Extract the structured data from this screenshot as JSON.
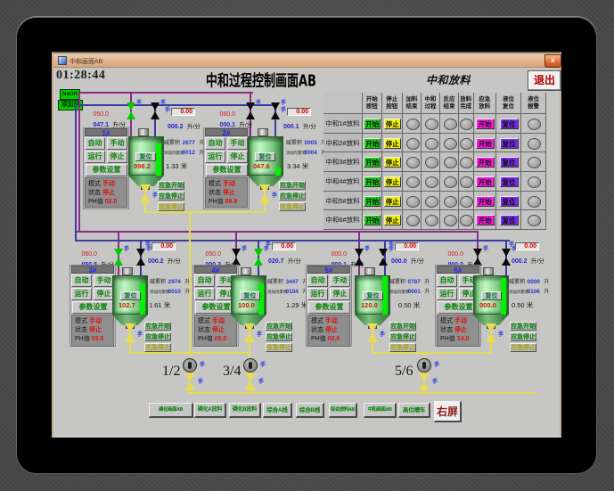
{
  "window": {
    "title": "中和画面AB",
    "close_label": "x"
  },
  "header": {
    "clock": "01:28:44",
    "title": "中和过程控制画面AB",
    "right_title": "中和放料",
    "exit_label": "退出"
  },
  "sources": [
    {
      "label": "NaOH"
    },
    {
      "label": "添加剂"
    }
  ],
  "labels": {
    "auto": "自动",
    "manual": "手动",
    "run": "运行",
    "stop": "停止",
    "param": "参数设置",
    "mode": "模式",
    "state": "状态",
    "ph": "PH值",
    "hand": "手",
    "emg": [
      "应急开始",
      "应急停止",
      "应急停止"
    ],
    "reset": "复位",
    "flow_unit": "升/分",
    "vol_unit": "升",
    "level_unit": "米",
    "acc1": "碱累积",
    "acc2": "添加剂累积"
  },
  "tanks": [
    {
      "id": "1#",
      "flow_set": "050.0",
      "flow_act": "047.1",
      "disp": "0.00",
      "disp_flow": "000.2",
      "acc1": "2677",
      "acc2": "0012",
      "value": "098.2",
      "level": "1.33",
      "mode": "手动",
      "state": "停止",
      "ph": "02.0",
      "valve_left_open": true,
      "valve_right_open": false,
      "level_bar": 39
    },
    {
      "id": "2#",
      "flow_set": "060.0",
      "flow_act": "000.1",
      "disp": "0.00",
      "disp_flow": "000.1",
      "acc1": "0005",
      "acc2": "0004",
      "value": "047.6",
      "level": "3.34",
      "mode": "手动",
      "state": "停止",
      "ph": "09.8",
      "valve_left_open": false,
      "valve_right_open": false,
      "level_bar": 12
    },
    {
      "id": "3#",
      "flow_set": "060.0",
      "flow_act": "050.5",
      "disp": "0.00",
      "disp_flow": "000.2",
      "acc1": "2974",
      "acc2": "0010",
      "value": "102.7",
      "level": "1.61",
      "mode": "手动",
      "state": "停止",
      "ph": "03.6",
      "valve_left_open": true,
      "valve_right_open": false,
      "level_bar": 38
    },
    {
      "id": "4#",
      "flow_set": "050.0",
      "flow_act": "000.3",
      "disp": "0.00",
      "disp_flow": "020.7",
      "acc1": "3447",
      "acc2": "0104",
      "value": "100.0",
      "level": "1.29",
      "mode": "手动",
      "state": "停止",
      "ph": "09.0",
      "valve_left_open": false,
      "valve_right_open": true,
      "level_bar": 38
    },
    {
      "id": "5#",
      "flow_set": "000.0",
      "flow_act": "000.1",
      "disp": "0.00",
      "disp_flow": "000.0",
      "acc1": "0787",
      "acc2": "0001",
      "value": "120.0",
      "level": "0.50",
      "mode": "手动",
      "state": "停止",
      "ph": "02.0",
      "valve_left_open": false,
      "valve_right_open": false,
      "level_bar": 46
    },
    {
      "id": "6#",
      "flow_set": "000.0",
      "flow_act": "000.0",
      "disp": "0.00",
      "disp_flow": "000.2",
      "acc1": "0000",
      "acc2": "0106",
      "value": "000.0",
      "level": "0.50",
      "mode": "手动",
      "state": "停止",
      "ph": "14.0",
      "valve_left_open": false,
      "valve_right_open": false,
      "level_bar": 44
    }
  ],
  "table": {
    "title": "中和放料",
    "col_headers": [
      [
        "开始",
        "按钮"
      ],
      [
        "停止",
        "按钮"
      ],
      [
        "加料",
        "结束"
      ],
      [
        "中和",
        "过程"
      ],
      [
        "反应",
        "结束"
      ],
      [
        "放料",
        "完成"
      ],
      [
        "应急",
        "放料"
      ],
      [
        "液位",
        "复位"
      ],
      [
        "液位",
        "报警"
      ]
    ],
    "rows": [
      {
        "label": "中和1#放料"
      },
      {
        "label": "中和2#放料"
      },
      {
        "label": "中和3#放料"
      },
      {
        "label": "中和4#放料"
      },
      {
        "label": "中和5#放料"
      },
      {
        "label": "中和6#放料"
      }
    ],
    "start": "开始",
    "stop": "停止",
    "emg_start": "开始",
    "reset": "复位"
  },
  "pumps": [
    {
      "label": "1/2"
    },
    {
      "label": "3/4"
    },
    {
      "label": "5/6"
    }
  ],
  "nav": {
    "buttons": [
      "磷化画面AB",
      "磷化A放料",
      "磷化B放料",
      "综合A线",
      "综合B线",
      "综合放料AB",
      "中和画面AB",
      "高位槽车"
    ],
    "right_screen": "右屏"
  }
}
